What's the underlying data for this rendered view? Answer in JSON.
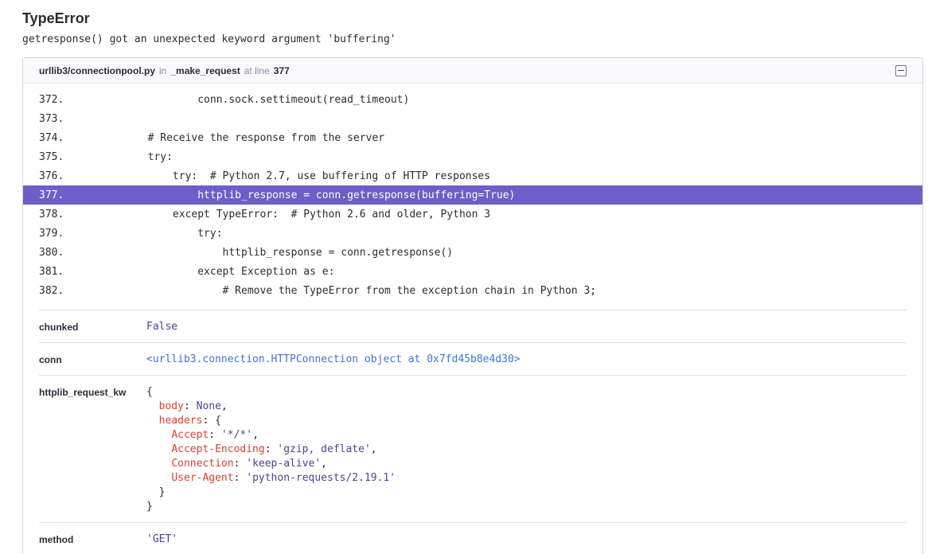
{
  "error": {
    "type": "TypeError",
    "message": "getresponse() got an unexpected keyword argument 'buffering'"
  },
  "frame": {
    "file": "urllib3/connectionpool.py",
    "in_label": "in",
    "function": "_make_request",
    "at_line_label": "at line",
    "line_number": "377",
    "collapse_icon": "minus-square-icon"
  },
  "code_lines": [
    {
      "ln": "372.",
      "src": "                conn.sock.settimeout(read_timeout)"
    },
    {
      "ln": "373.",
      "src": ""
    },
    {
      "ln": "374.",
      "src": "        # Receive the response from the server"
    },
    {
      "ln": "375.",
      "src": "        try:"
    },
    {
      "ln": "376.",
      "src": "            try:  # Python 2.7, use buffering of HTTP responses"
    },
    {
      "ln": "377.",
      "src": "                httplib_response = conn.getresponse(buffering=True)"
    },
    {
      "ln": "378.",
      "src": "            except TypeError:  # Python 2.6 and older, Python 3"
    },
    {
      "ln": "379.",
      "src": "                try:"
    },
    {
      "ln": "380.",
      "src": "                    httplib_response = conn.getresponse()"
    },
    {
      "ln": "381.",
      "src": "                except Exception as e:"
    },
    {
      "ln": "382.",
      "src": "                    # Remove the TypeError from the exception chain in Python 3;"
    }
  ],
  "active_line": "377.",
  "vars": {
    "chunked": {
      "key": "chunked",
      "value": "False"
    },
    "conn": {
      "key": "conn",
      "value": "<urllib3.connection.HTTPConnection object at 0x7fd45b8e4d30>"
    },
    "httplib_request_kw": {
      "key": "httplib_request_kw",
      "open": "{",
      "body_key": "body",
      "body_val": "None",
      "headers_key": "headers",
      "headers_open": "{",
      "accept_key": "Accept",
      "accept_val": "'*/*'",
      "ae_key": "Accept-Encoding",
      "ae_val": "'gzip, deflate'",
      "conn_key": "Connection",
      "conn_val": "'keep-alive'",
      "ua_key": "User-Agent",
      "ua_val": "'python-requests/2.19.1'",
      "headers_close": "}",
      "close": "}"
    },
    "method": {
      "key": "method",
      "value": "'GET'"
    }
  },
  "colors": {
    "accent": "#6c5fc7",
    "key_red": "#e03e2f",
    "value_purple": "#4c4390",
    "object_blue": "#3d74db"
  }
}
